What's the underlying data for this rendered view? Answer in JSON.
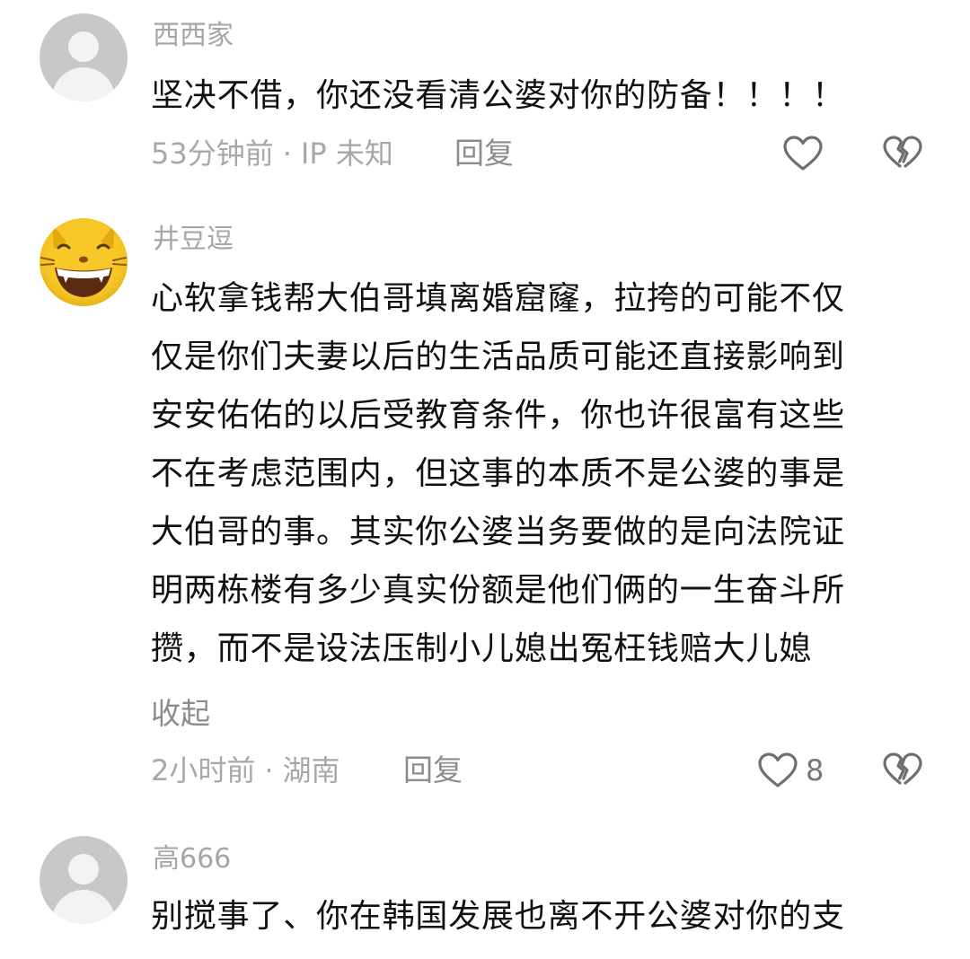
{
  "comments": [
    {
      "username": "西西家",
      "lines": [
        "坚决不借，你还没看清公婆对你的防备！！！！"
      ],
      "time": "53分钟前",
      "location": "IP 未知",
      "reply_label": "回复",
      "like_count": "",
      "avatar": "default-avatar"
    },
    {
      "username": "井豆逗",
      "lines": [
        "心软拿钱帮大伯哥填离婚窟窿，拉挎的可能不仅",
        "仅是你们夫妻以后的生活品质可能还直接影响到",
        "安安佑佑的以后受教育条件，你也许很富有这些",
        "不在考虑范围内，但这事的本质不是公婆的事是",
        "大伯哥的事。其实你公婆当务要做的是向法院证",
        "明两栋楼有多少真实份额是他们俩的一生奋斗所",
        "攒，而不是设法压制小儿媳出冤枉钱赔大儿媳"
      ],
      "collapse_label": "收起",
      "time": "2小时前",
      "location": "湖南",
      "reply_label": "回复",
      "like_count": "8",
      "avatar": "cat-emoji-avatar"
    },
    {
      "username": "高666",
      "lines": [
        "别搅事了、你在韩国发展也离不开公婆对你的支"
      ],
      "avatar": "default-avatar"
    }
  ],
  "icons": {
    "like": "heart-outline-icon",
    "dislike": "broken-heart-icon"
  },
  "colors": {
    "text": "#111111",
    "meta": "#a8a8a8",
    "icon": "#6f6f6f",
    "avatar_default": "#c8c8c8",
    "avatar_emoji": "#f7c827"
  }
}
